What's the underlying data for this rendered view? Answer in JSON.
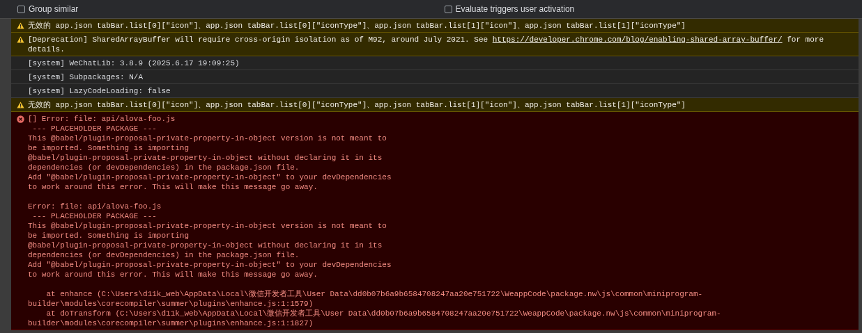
{
  "toolbar": {
    "checkboxes": [
      {
        "label": "Group similar",
        "checked": false
      },
      {
        "label": "Evaluate triggers user activation",
        "checked": false
      }
    ]
  },
  "messages": [
    {
      "kind": "warning",
      "segments": [
        {
          "kind": "text",
          "text": "无效的 app.json tabBar.list[0][\"icon\"]、app.json tabBar.list[0][\"iconType\"]、app.json tabBar.list[1][\"icon\"]、app.json tabBar.list[1][\"iconType\"]"
        }
      ]
    },
    {
      "kind": "warning",
      "segments": [
        {
          "kind": "text",
          "text": "[Deprecation] SharedArrayBuffer will require cross-origin isolation as of M92, around July 2021. See "
        },
        {
          "kind": "link",
          "text": "https://developer.chrome.com/blog/enabling-shared-array-buffer/"
        },
        {
          "kind": "text",
          "text": " for more details."
        }
      ]
    },
    {
      "kind": "info",
      "segments": [
        {
          "kind": "text",
          "text": "[system] WeChatLib: 3.8.9 (2025.6.17 19:09:25)"
        }
      ]
    },
    {
      "kind": "info",
      "segments": [
        {
          "kind": "text",
          "text": "[system] Subpackages: N/A"
        }
      ]
    },
    {
      "kind": "info",
      "segments": [
        {
          "kind": "text",
          "text": "[system] LazyCodeLoading: false"
        }
      ]
    },
    {
      "kind": "warning",
      "segments": [
        {
          "kind": "text",
          "text": "无效的 app.json tabBar.list[0][\"icon\"]、app.json tabBar.list[0][\"iconType\"]、app.json tabBar.list[1][\"icon\"]、app.json tabBar.list[1][\"iconType\"]"
        }
      ]
    },
    {
      "kind": "error",
      "blocks": [
        [
          "[] Error: file: api/alova-foo.js",
          " --- PLACEHOLDER PACKAGE ---",
          "This @babel/plugin-proposal-private-property-in-object version is not meant to",
          "be imported. Something is importing",
          "@babel/plugin-proposal-private-property-in-object without declaring it in its",
          "dependencies (or devDependencies) in the package.json file.",
          "Add \"@babel/plugin-proposal-private-property-in-object\" to your devDependencies",
          "to work around this error. This will make this message go away."
        ],
        [
          "Error: file: api/alova-foo.js",
          " --- PLACEHOLDER PACKAGE ---",
          "This @babel/plugin-proposal-private-property-in-object version is not meant to",
          "be imported. Something is importing",
          "@babel/plugin-proposal-private-property-in-object without declaring it in its",
          "dependencies (or devDependencies) in the package.json file.",
          "Add \"@babel/plugin-proposal-private-property-in-object\" to your devDependencies",
          "to work around this error. This will make this message go away."
        ],
        [
          "    at enhance (C:\\Users\\d11k_web\\AppData\\Local\\微信开发者工具\\User Data\\dd0b07b6a9b6584708247aa20e751722\\WeappCode\\package.nw\\js\\common\\miniprogram-",
          "builder\\modules\\corecompiler\\summer\\plugins\\enhance.js:1:1579)",
          "    at doTransform (C:\\Users\\d11k_web\\AppData\\Local\\微信开发者工具\\User Data\\dd0b07b6a9b6584708247aa20e751722\\WeappCode\\package.nw\\js\\common\\miniprogram-",
          "builder\\modules\\corecompiler\\summer\\plugins\\enhance.js:1:1827)"
        ]
      ]
    }
  ]
}
